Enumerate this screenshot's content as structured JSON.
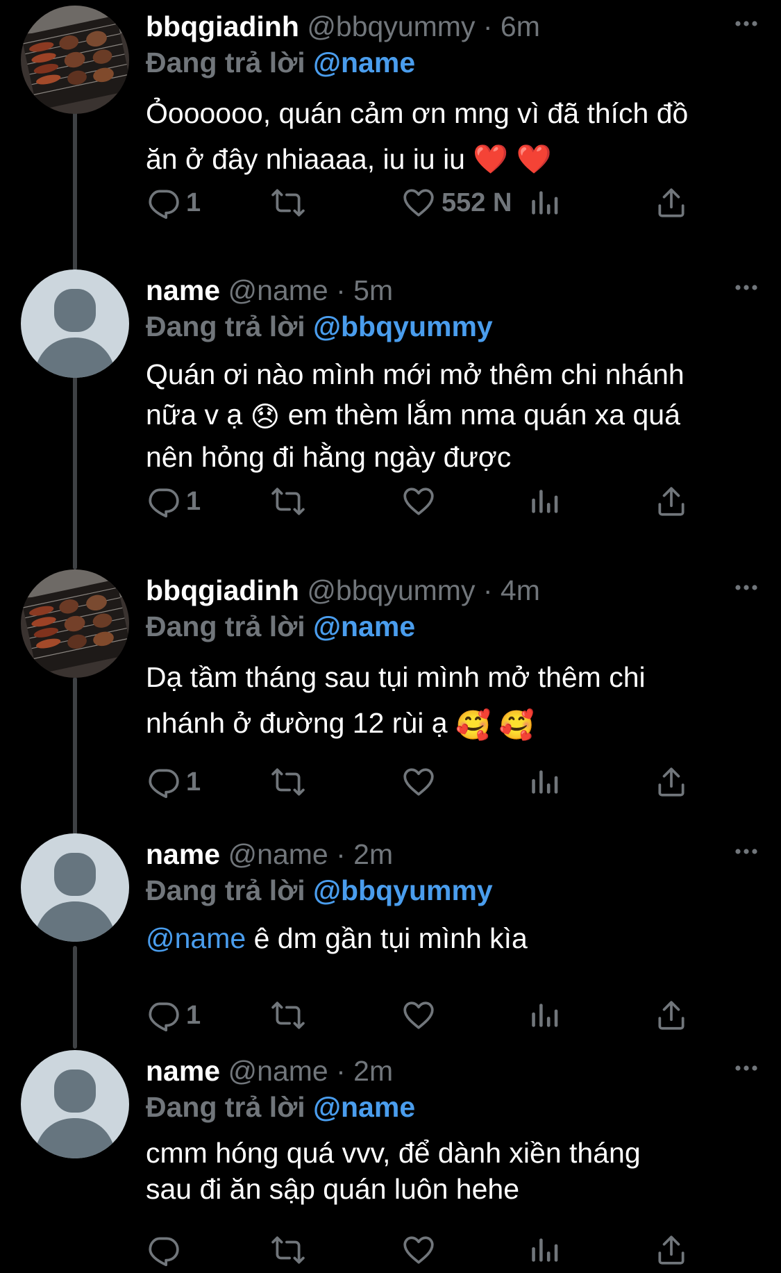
{
  "tweets": [
    {
      "name": "bbqgiadinh",
      "handle": "@bbqyummy",
      "dot": "·",
      "time": "6m",
      "reply_prefix": "Đang trả lời",
      "reply_to": "@name",
      "text_line1": "Ỏoooooo, quán cảm ơn mng vì đã thích đồ",
      "text_line2": "ăn ở đây nhiaaaa, iu iu iu",
      "emoji1": "❤️",
      "emoji2": "❤️",
      "reply_count": "1",
      "like_count": "552 N",
      "avatar": "bbq-grill-photo"
    },
    {
      "name": "name",
      "handle": "@name",
      "dot": "·",
      "time": "5m",
      "reply_prefix": "Đang trả lời",
      "reply_to": "@bbqyummy",
      "text_line1": "Quán ơi nào mình mới mở thêm chi nhánh",
      "text_line2a": "nữa v ạ",
      "emoji1": "😞",
      "text_line2b": "em thèm lắm nma quán xa quá",
      "text_line3": "nên hỏng đi hằng ngày được",
      "reply_count": "1",
      "avatar": "default-avatar"
    },
    {
      "name": "bbqgiadinh",
      "handle": "@bbqyummy",
      "dot": "·",
      "time": "4m",
      "reply_prefix": "Đang trả lời",
      "reply_to": "@name",
      "text_line1": "Dạ tầm tháng sau tụi mình mở thêm chi",
      "text_line2": "nhánh ở đường 12 rùi ạ",
      "emoji1": "🥰",
      "emoji2": "🥰",
      "reply_count": "1",
      "avatar": "bbq-grill-photo"
    },
    {
      "name": "name",
      "handle": "@name",
      "dot": "·",
      "time": "2m",
      "reply_prefix": "Đang trả lời",
      "reply_to": "@bbqyummy",
      "text_mention": "@name",
      "text_rest": "ê dm gần tụi mình kìa",
      "reply_count": "1",
      "avatar": "default-avatar"
    },
    {
      "name": "name",
      "handle": "@name",
      "dot": "·",
      "time": "2m",
      "reply_prefix": "Đang trả lời",
      "reply_to": "@name",
      "text_line1": "cmm hóng quá vvv, để dành xiền tháng",
      "text_line2": "sau đi ăn sập quán luôn hehe",
      "avatar": "default-avatar"
    }
  ],
  "colors": {
    "background": "#000000",
    "secondary_text": "#71767b",
    "link": "#4a9ded",
    "thread_line": "#3e4144"
  },
  "icons": [
    "reply-icon",
    "retweet-icon",
    "like-icon",
    "views-icon",
    "share-icon",
    "more-icon"
  ]
}
